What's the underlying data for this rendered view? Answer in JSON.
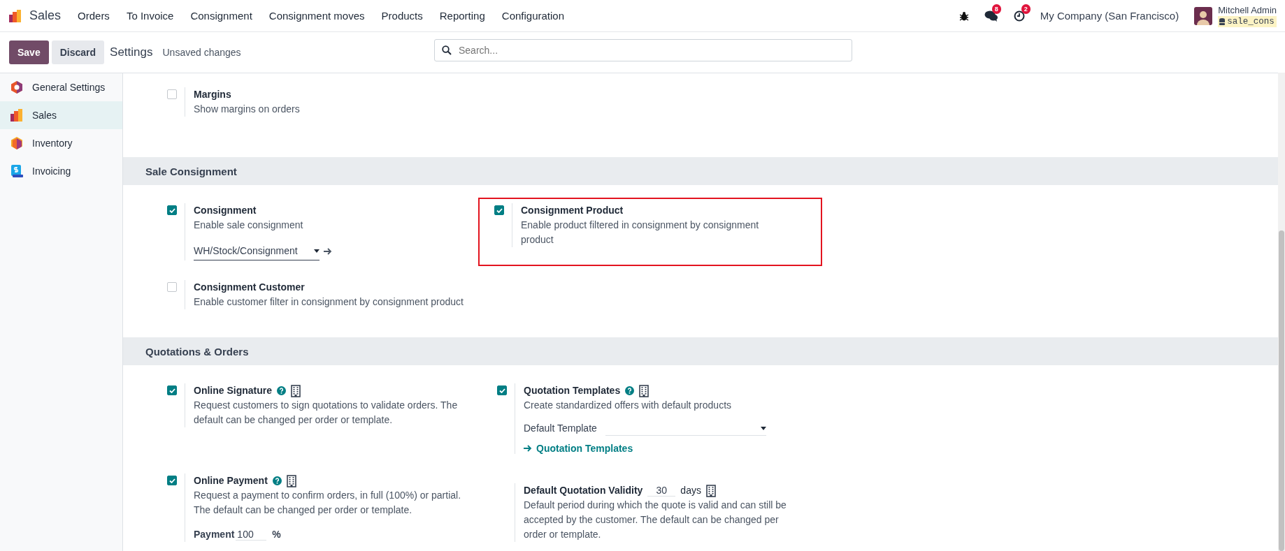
{
  "brand": "Sales",
  "menu": [
    "Orders",
    "To Invoice",
    "Consignment",
    "Consignment moves",
    "Products",
    "Reporting",
    "Configuration"
  ],
  "systray": {
    "messages_count": "8",
    "activities_count": "2",
    "company": "My Company (San Francisco)",
    "user": "Mitchell Admin",
    "database": "sale_cons"
  },
  "control_bar": {
    "save": "Save",
    "discard": "Discard",
    "title": "Settings",
    "status": "Unsaved changes",
    "search": {
      "placeholder": "Search..."
    }
  },
  "sidebar": {
    "items": [
      {
        "kind": "general",
        "label": "General Settings",
        "selected": false
      },
      {
        "kind": "sales",
        "label": "Sales",
        "selected": true
      },
      {
        "kind": "inventory",
        "label": "Inventory",
        "selected": false
      },
      {
        "kind": "invoicing",
        "label": "Invoicing",
        "selected": false
      }
    ]
  },
  "sections": [
    {
      "settings": [
        {
          "kind": "checkbox",
          "label": "Margins",
          "checked": false,
          "help": false,
          "company": false,
          "highlighted": false,
          "description": "Show margins on orders"
        }
      ]
    },
    {
      "title": "Sale Consignment",
      "settings": [
        {
          "kind": "checkbox",
          "label": "Consignment",
          "checked": true,
          "help": false,
          "company": false,
          "highlighted": false,
          "description": "Enable sale consignment",
          "controls": [
            {
              "kind": "many2one",
              "value": "WH/Stock/Consignment"
            }
          ]
        },
        {
          "kind": "checkbox",
          "label": "Consignment Product",
          "checked": true,
          "help": false,
          "company": false,
          "highlighted": true,
          "description": "Enable product filtered in consignment by consignment product"
        },
        {
          "kind": "checkbox",
          "label": "Consignment Customer",
          "checked": false,
          "help": false,
          "company": false,
          "highlighted": false,
          "description": "Enable customer filter in consignment by consignment product"
        }
      ]
    },
    {
      "title": "Quotations & Orders",
      "settings": [
        {
          "kind": "checkbox",
          "label": "Online Signature",
          "checked": true,
          "help": true,
          "company": true,
          "highlighted": false,
          "description": "Request customers to sign quotations to validate orders. The default can be changed per order or template."
        },
        {
          "kind": "checkbox",
          "label": "Quotation Templates",
          "checked": true,
          "help": true,
          "company": true,
          "highlighted": false,
          "description": "Create standardized offers with default products",
          "controls": [
            {
              "kind": "select",
              "label": "Default Template"
            },
            {
              "kind": "link",
              "label": "Quotation Templates"
            }
          ]
        },
        {
          "kind": "checkbox",
          "label": "Online Payment",
          "checked": true,
          "help": true,
          "company": true,
          "highlighted": false,
          "description": "Request a payment to confirm orders, in full (100%) or partial. The default can be changed per order or template.",
          "controls": [
            {
              "kind": "number",
              "label": "Payment",
              "value": "100",
              "unit": "%"
            }
          ]
        },
        {
          "kind": "field",
          "label": "Default Quotation Validity",
          "value": "30",
          "unit": "days",
          "company": true,
          "highlighted": false,
          "description": "Default period during which the quote is valid and can still be accepted by the customer. The default can be changed per order or template."
        }
      ]
    }
  ]
}
